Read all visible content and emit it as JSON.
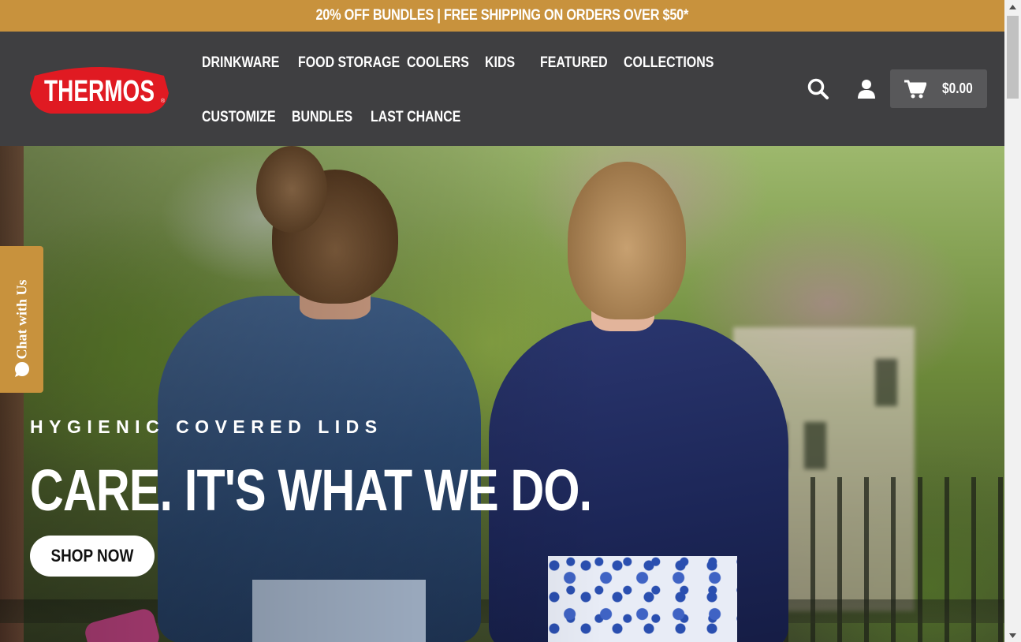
{
  "announcement": {
    "text": "20% OFF BUNDLES | FREE SHIPPING ON ORDERS OVER $50*"
  },
  "brand": {
    "logo_text": "THERMOS",
    "logo_color": "#e01a22"
  },
  "nav": {
    "items": [
      {
        "label": "DRINKWARE"
      },
      {
        "label": "FOOD STORAGE"
      },
      {
        "label": "COOLERS"
      },
      {
        "label": "KIDS"
      },
      {
        "label": "FEATURED"
      },
      {
        "label": "COLLECTIONS"
      },
      {
        "label": "CUSTOMIZE"
      },
      {
        "label": "BUNDLES"
      },
      {
        "label": "LAST CHANCE"
      }
    ]
  },
  "header_icons": {
    "search": "search-icon",
    "account": "user-icon",
    "cart": "cart-icon"
  },
  "cart": {
    "total": "$0.00"
  },
  "hero": {
    "subtitle": "HYGIENIC COVERED LIDS",
    "title": "CARE. IT'S WHAT WE DO.",
    "cta": "SHOP NOW"
  },
  "chat": {
    "label": "Chat with Us",
    "icon": "chat-bubble-icon"
  },
  "colors": {
    "accent": "#c8923d",
    "header_bg": "#3f3f41",
    "cart_bg": "#58585a"
  }
}
